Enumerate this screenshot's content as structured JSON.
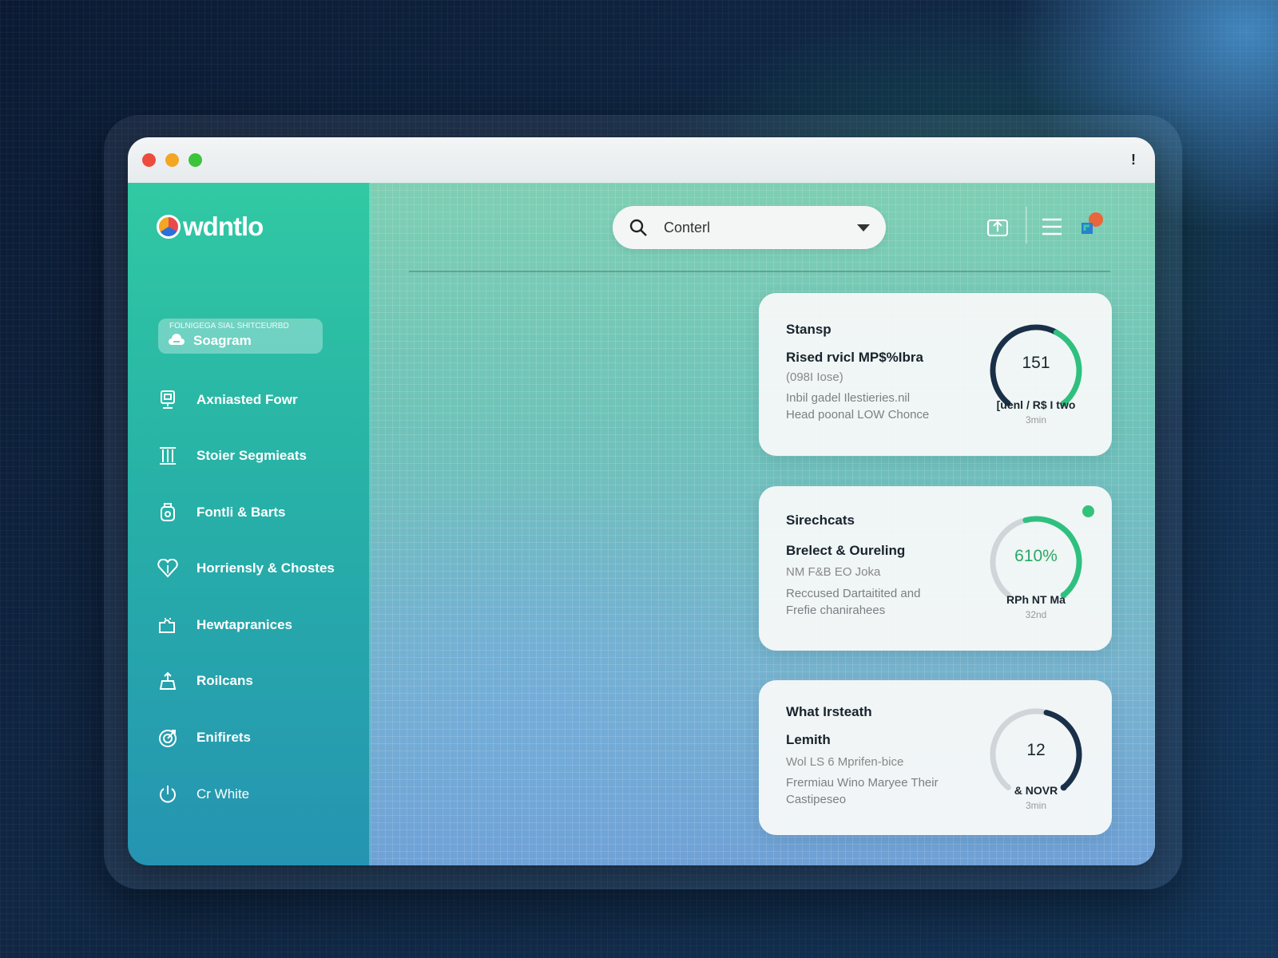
{
  "window": {
    "title_glyph": "!"
  },
  "sidebar": {
    "logo": "wdntlo",
    "chip": {
      "caption": "FOLNIGEGA SIAL SHITCEURBD",
      "label": "Soagram"
    },
    "items": [
      {
        "label": "Axniasted Fowr",
        "icon": "monitor-icon"
      },
      {
        "label": "Stoier Segmieats",
        "icon": "pillar-icon"
      },
      {
        "label": "Fontli & Barts",
        "icon": "jar-icon"
      },
      {
        "label": "Horriensly & Chostes",
        "icon": "heart-icon"
      },
      {
        "label": "Hewtapranices",
        "icon": "puzzle-icon"
      },
      {
        "label": "Roilcans",
        "icon": "weight-icon"
      },
      {
        "label": "Enifirets",
        "icon": "target-icon"
      },
      {
        "label": "Cr White",
        "icon": "power-icon"
      }
    ]
  },
  "header": {
    "search": {
      "value": "Conterl",
      "icon": "search-icon"
    },
    "actions": [
      "export-icon",
      "menu-icon",
      "profile-icon"
    ]
  },
  "cards": [
    {
      "title": "Stansp",
      "subtitle": "Rised rvicl MP$%Ibra",
      "meta": "(098I Iose)",
      "description": [
        "Inbil gadel Ilestieries.nil",
        "Head poonal LOW Chonce"
      ],
      "gauge": {
        "value": "151",
        "label": "[uenl / R$ I two",
        "caption": "3min",
        "fraction": 0.6,
        "colors": [
          "#1a3048",
          "#2fc07f"
        ]
      },
      "status_dot": false
    },
    {
      "title": "Sirechcats",
      "subtitle": "Brelect & Oureling",
      "meta": "NM F&B EO Joka",
      "description": [
        "Reccused Dartaitited and",
        "Frefie chanirahees"
      ],
      "gauge": {
        "value": "610%",
        "label": "RPh NT Ma",
        "caption": "32nd",
        "fraction": 0.45,
        "colors": [
          "#cfd5d8",
          "#2fc07f"
        ]
      },
      "status_dot": true
    },
    {
      "title": "What Irsteath",
      "subtitle": "Lemith",
      "meta": "Wol LS 6 Mprifen-bice",
      "description": [
        "Frermiau Wino Maryee Their",
        "Castipeseo"
      ],
      "gauge": {
        "value": "12",
        "label": "& NOVR",
        "caption": "3min",
        "fraction": 0.55,
        "colors": [
          "#cfd5d8",
          "#1a3048"
        ]
      },
      "status_dot": false
    }
  ],
  "colors": {
    "accent_green": "#2fc07f",
    "navy": "#1a3048",
    "sidebar_top": "#31c9a3",
    "sidebar_bottom": "#2594b2"
  }
}
